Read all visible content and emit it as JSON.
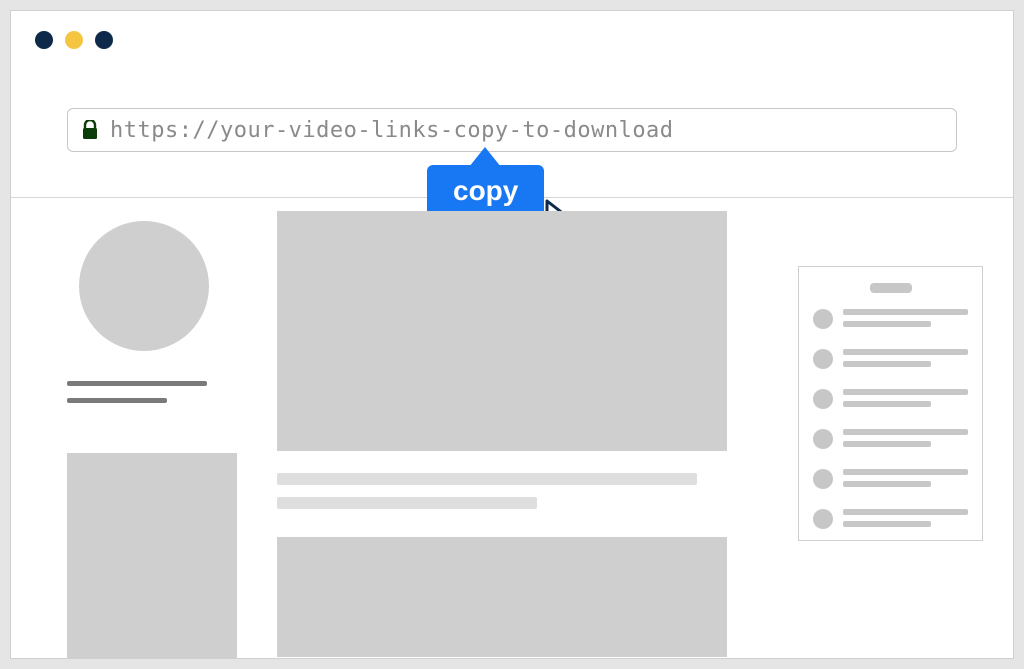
{
  "address_bar": {
    "url": "https://your-video-links-copy-to-download"
  },
  "tooltip": {
    "label": "copy"
  }
}
